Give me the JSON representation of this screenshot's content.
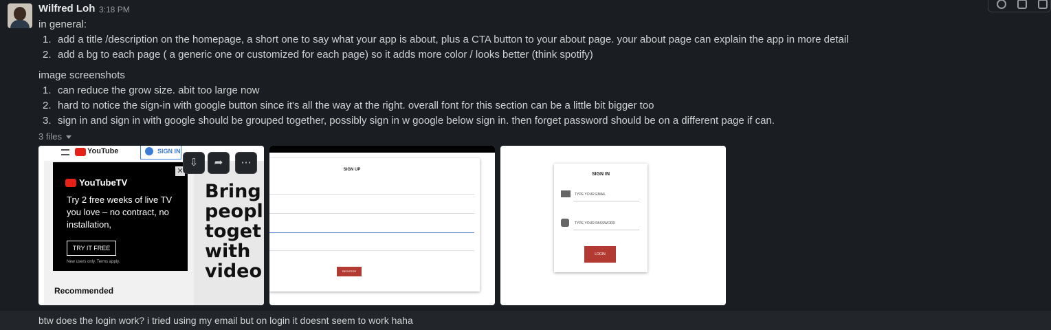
{
  "message": {
    "author": "Wilfred Loh",
    "time": "3:18 PM",
    "intro": "in general:",
    "general_items": [
      "add a title /description on the homepage, a short one to say what your app is about, plus a CTA button to your about page. your about page can explain the app in more detail",
      "add a bg to each page ( a generic one or customized for each page) so it adds more color / looks better (think spotify)"
    ],
    "screenshots_heading": "image screenshots",
    "screenshot_items": [
      "can reduce the grow size. abit too large now",
      "hard to notice the sign-in with google button since it's all the way at the right. overall font for this section can be a little bit bigger too",
      "sign in and sign in with google should be grouped together, possibly sign in w google below sign in. then forget password should be on a different page if can."
    ],
    "files_label": "3 files"
  },
  "thumb1": {
    "youtube": "YouTube",
    "sign_in": "SIGN IN",
    "ad_brand": "YouTubeTV",
    "ad_text": "Try 2 free weeks of live TV you love – no contract, no installation,",
    "ad_button": "TRY IT FREE",
    "ad_note": "New users only. Terms apply.",
    "recommended": "Recommended",
    "bring": "Bring people togeth with video"
  },
  "thumb2": {
    "title": "SIGN UP",
    "button": "REGISTER"
  },
  "thumb3": {
    "title": "SIGN IN",
    "email_placeholder": "TYPE YOUR EMAIL",
    "password_placeholder": "TYPE YOUR PASSWORD",
    "button": "LOGIN"
  },
  "next_message": "btw does the login work? i tried using my email but on login it doesnt seem to work haha",
  "colors": {
    "bg": "#1a1d21",
    "accent_red": "#b33a32"
  }
}
